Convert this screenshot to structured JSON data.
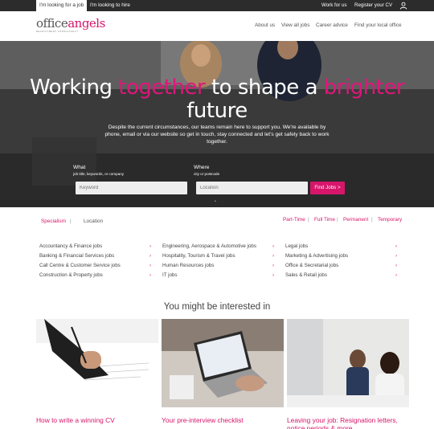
{
  "topbar": {
    "tab_job": "I'm looking for a job",
    "tab_hire": "I'm looking to hire",
    "work_for_us": "Work for us",
    "register_cv": "Register your CV",
    "user_icon": "user-icon"
  },
  "header": {
    "logo_office": "office",
    "logo_angels": "angels",
    "logo_tagline": "RECRUITMENT CONSULTANCY",
    "nav": [
      "About us",
      "View all jobs",
      "Career advice",
      "Find your local office"
    ]
  },
  "hero": {
    "title_parts": [
      "Working ",
      "together",
      " to shape a ",
      "brighter",
      " future"
    ],
    "text": "Despite the current circumstances, our teams remain here to support you. We're available by phone, email or via our website so get in touch, stay connected and let's get safely back to work together.",
    "what_label": "What",
    "what_sub": "job title, keywords, or company",
    "what_placeholder": "Keyword",
    "where_label": "Where",
    "where_sub": "city or postcode",
    "where_placeholder": "Location",
    "find_button": "Find Jobs >",
    "dot": "•"
  },
  "filters": {
    "left": [
      "Specialism",
      "Location"
    ],
    "right": [
      "Part-Time",
      "Full Time",
      "Permanent",
      "Temporary"
    ],
    "separator": "|"
  },
  "categories": {
    "col1": [
      "Accountancy & Finance jobs",
      "Banking & Financial Services jobs",
      "Call Centre & Customer Service jobs",
      "Construction & Property jobs"
    ],
    "col2": [
      "Engineering, Aerospace & Automotive jobs",
      "Hospitality, Tourism & Travel jobs",
      "Human Resources jobs",
      "IT jobs"
    ],
    "col3": [
      "Legal jobs",
      "Marketing & Advertising jobs",
      "Office & Secretarial jobs",
      "Sales & Retail jobs"
    ],
    "chevron": "›"
  },
  "interested": {
    "title": "You might be interested in",
    "cards": [
      {
        "title": "How to write a winning CV"
      },
      {
        "title": "Your pre-interview checklist"
      },
      {
        "title": "Leaving your job: Resignation letters, notice periods & more"
      }
    ]
  },
  "colors": {
    "brand_pink": "#d7156b",
    "topbar_dark": "#2c2c2c"
  }
}
